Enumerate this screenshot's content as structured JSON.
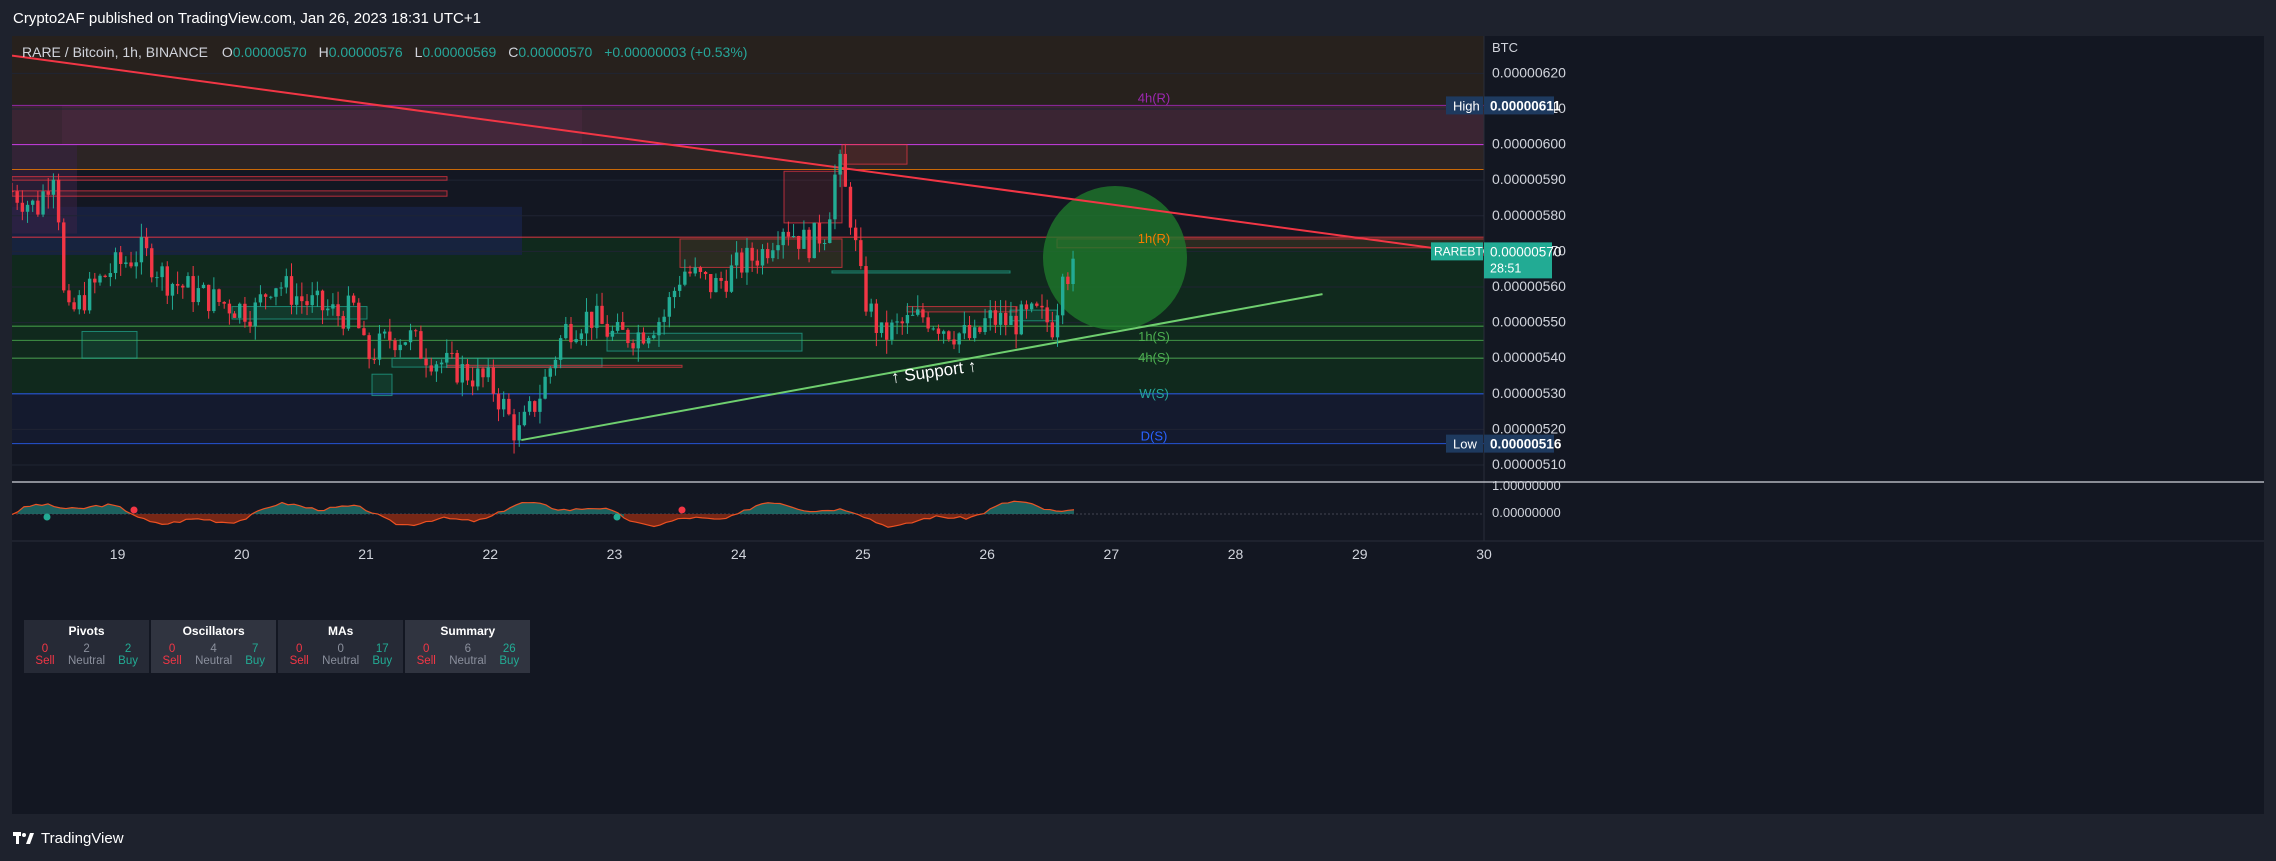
{
  "header": {
    "published": "Crypto2AF published on TradingView.com, Jan 26, 2023 18:31 UTC+1"
  },
  "legend": {
    "symbol": "RARE / Bitcoin, 1h, BINANCE",
    "o_label": "O",
    "o": "0.00000570",
    "h_label": "H",
    "h": "0.00000576",
    "l_label": "L",
    "l": "0.00000569",
    "c_label": "C",
    "c": "0.00000570",
    "change": "+0.00000003 (+0.53%)"
  },
  "tech_summary": [
    {
      "title": "Pivots",
      "sell": "0",
      "neutral": "2",
      "buy": "2"
    },
    {
      "title": "Oscillators",
      "sell": "0",
      "neutral": "4",
      "buy": "7"
    },
    {
      "title": "MAs",
      "sell": "0",
      "neutral": "0",
      "buy": "17"
    },
    {
      "title": "Summary",
      "sell": "0",
      "neutral": "6",
      "buy": "26"
    }
  ],
  "tech_labels": {
    "sell": "Sell",
    "neutral": "Neutral",
    "buy": "Buy"
  },
  "footer": {
    "brand": "TradingView"
  },
  "colors": {
    "up": "#22ab94",
    "down": "#f23645",
    "resistance": "#f23645",
    "support": "#4caf50",
    "blue": "#2962ff",
    "purple": "#9c27b0"
  },
  "chart_data": {
    "type": "candlestick",
    "symbol": "RARE / Bitcoin",
    "interval": "1h",
    "exchange": "BINANCE",
    "currency": "BTC",
    "ylim": [
      5.055e-06,
      6.305e-06
    ],
    "y_ticks": [
      "0.00000510",
      "0.00000520",
      "0.00000530",
      "0.00000540",
      "0.00000550",
      "0.00000560",
      "0.00000570",
      "0.00000580",
      "0.00000590",
      "0.00000600",
      "0.00000610",
      "0.00000620"
    ],
    "x_ticks": [
      {
        "label": "19",
        "day": 19
      },
      {
        "label": "20",
        "day": 20
      },
      {
        "label": "21",
        "day": 21
      },
      {
        "label": "22",
        "day": 22
      },
      {
        "label": "23",
        "day": 23
      },
      {
        "label": "24",
        "day": 24
      },
      {
        "label": "25",
        "day": 25
      },
      {
        "label": "26",
        "day": 26
      },
      {
        "label": "27",
        "day": 27
      },
      {
        "label": "28",
        "day": 28
      },
      {
        "label": "29",
        "day": 29
      },
      {
        "label": "30",
        "day": 30
      }
    ],
    "x_range_days": [
      18.15,
      30.0
    ],
    "price_path": [
      [
        18.15,
        5.87e-06
      ],
      [
        18.35,
        5.82e-06
      ],
      [
        18.5,
        5.95e-06
      ],
      [
        18.58,
        5.5e-06
      ],
      [
        18.75,
        5.58e-06
      ],
      [
        18.95,
        5.65e-06
      ],
      [
        19.2,
        5.7e-06
      ],
      [
        19.4,
        5.62e-06
      ],
      [
        19.8,
        5.56e-06
      ],
      [
        20.1,
        5.53e-06
      ],
      [
        20.25,
        5.62e-06
      ],
      [
        20.5,
        5.56e-06
      ],
      [
        20.8,
        5.52e-06
      ],
      [
        20.9,
        5.54e-06
      ],
      [
        21.0,
        5.4e-06
      ],
      [
        21.2,
        5.46e-06
      ],
      [
        21.35,
        5.46e-06
      ],
      [
        21.45,
        5.42e-06
      ],
      [
        21.65,
        5.38e-06
      ],
      [
        21.8,
        5.36e-06
      ],
      [
        22.0,
        5.33e-06
      ],
      [
        22.1,
        5.27e-06
      ],
      [
        22.22,
        5.18e-06
      ],
      [
        22.4,
        5.3e-06
      ],
      [
        22.6,
        5.48e-06
      ],
      [
        22.8,
        5.52e-06
      ],
      [
        23.0,
        5.46e-06
      ],
      [
        23.2,
        5.47e-06
      ],
      [
        23.4,
        5.52e-06
      ],
      [
        23.55,
        5.65e-06
      ],
      [
        23.8,
        5.6e-06
      ],
      [
        24.0,
        5.66e-06
      ],
      [
        24.2,
        5.7e-06
      ],
      [
        24.35,
        5.78e-06
      ],
      [
        24.55,
        5.72e-06
      ],
      [
        24.7,
        5.76e-06
      ],
      [
        24.8,
        5.96e-06
      ],
      [
        24.9,
        5.8e-06
      ],
      [
        25.0,
        5.58e-06
      ],
      [
        25.15,
        5.46e-06
      ],
      [
        25.3,
        5.49e-06
      ],
      [
        25.5,
        5.52e-06
      ],
      [
        25.7,
        5.48e-06
      ],
      [
        25.9,
        5.45e-06
      ],
      [
        26.0,
        5.51e-06
      ],
      [
        26.2,
        5.5e-06
      ],
      [
        26.4,
        5.52e-06
      ],
      [
        26.55,
        5.49e-06
      ],
      [
        26.6,
        5.68e-06
      ],
      [
        26.68,
        5.62e-06
      ],
      [
        26.72,
        5.7e-06
      ]
    ],
    "annotations": [
      {
        "text": "4h(R)",
        "price": 6.13e-06,
        "color": "#9c27b0"
      },
      {
        "text": "1h(R)",
        "price": 5.735e-06,
        "color": "#f57c00"
      },
      {
        "text": "1h(S)",
        "price": 5.46e-06,
        "color": "#4caf50"
      },
      {
        "text": "4h(S)",
        "price": 5.4e-06,
        "color": "#4caf50"
      },
      {
        "text": "W(S)",
        "price": 5.3e-06,
        "color": "#26a69a"
      },
      {
        "text": "D(S)",
        "price": 5.18e-06,
        "color": "#2962ff"
      },
      {
        "text": "↑ Support ↑",
        "price": 5.33e-06,
        "color": "#ffffff"
      }
    ],
    "resistance_line": {
      "from": [
        18.15,
        6.25e-06
      ],
      "to": [
        30.0,
        5.69e-06
      ]
    },
    "support_line": {
      "from": [
        22.25,
        5.17e-06
      ],
      "to": [
        28.7,
        5.58e-06
      ]
    },
    "levels": [
      {
        "price": 6.11e-06,
        "color": "#9c27b0"
      },
      {
        "price": 6e-06,
        "color": "#e040fb"
      },
      {
        "price": 5.93e-06,
        "color": "#f57c00"
      },
      {
        "price": 5.74e-06,
        "color": "#f23645"
      },
      {
        "price": 5.49e-06,
        "color": "#4caf50"
      },
      {
        "price": 5.45e-06,
        "color": "#4caf50"
      },
      {
        "price": 5.4e-06,
        "color": "#4caf50"
      },
      {
        "price": 5.3e-06,
        "color": "#2962ff"
      },
      {
        "price": 5.16e-06,
        "color": "#2962ff"
      }
    ],
    "price_labels": [
      {
        "tag": "High",
        "value": "0.00000611",
        "price": 6.11e-06
      },
      {
        "tag": "RAREBTC",
        "value": "0.00000570",
        "countdown": "28:51",
        "price": 5.7e-06
      },
      {
        "tag": "Low",
        "value": "0.00000516",
        "price": 5.16e-06
      }
    ],
    "oscillator": {
      "ticks": [
        "1.00000000",
        "0.00000000"
      ]
    }
  }
}
